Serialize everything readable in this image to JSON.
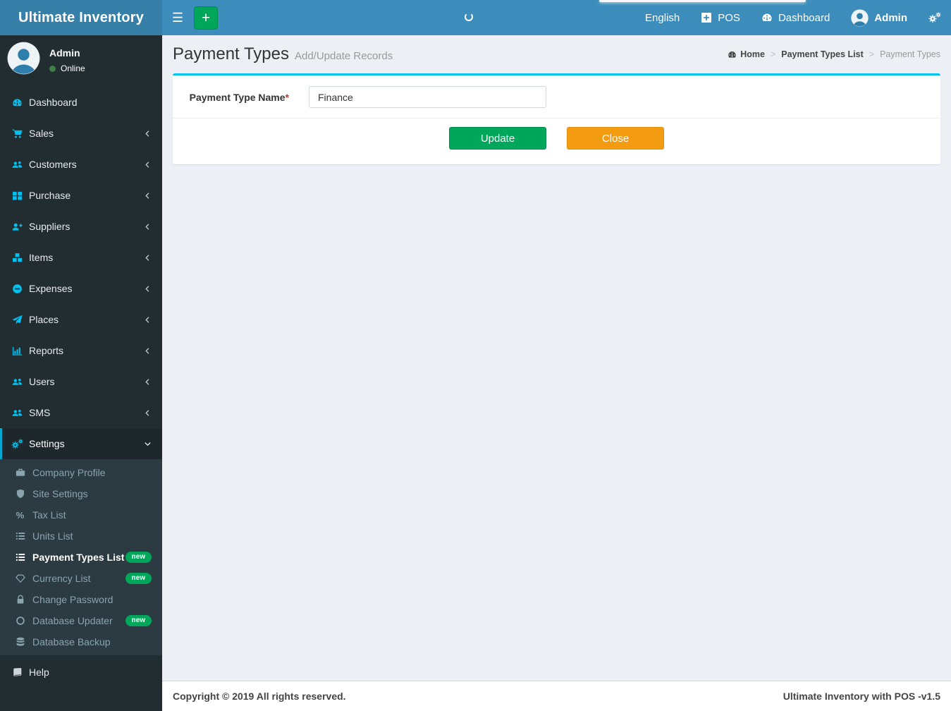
{
  "app": {
    "title": "Ultimate Inventory"
  },
  "navbar": {
    "language": "English",
    "pos": "POS",
    "dashboard": "Dashboard",
    "user": "Admin"
  },
  "sidebar": {
    "user": {
      "name": "Admin",
      "status": "Online"
    },
    "items": [
      {
        "label": "Dashboard",
        "expandable": false
      },
      {
        "label": "Sales",
        "expandable": true
      },
      {
        "label": "Customers",
        "expandable": true
      },
      {
        "label": "Purchase",
        "expandable": true
      },
      {
        "label": "Suppliers",
        "expandable": true
      },
      {
        "label": "Items",
        "expandable": true
      },
      {
        "label": "Expenses",
        "expandable": true
      },
      {
        "label": "Places",
        "expandable": true
      },
      {
        "label": "Reports",
        "expandable": true
      },
      {
        "label": "Users",
        "expandable": true
      },
      {
        "label": "SMS",
        "expandable": true
      },
      {
        "label": "Settings",
        "expandable": true,
        "active": true
      }
    ],
    "submenu": [
      {
        "label": "Company Profile"
      },
      {
        "label": "Site Settings"
      },
      {
        "label": "Tax List"
      },
      {
        "label": "Units List"
      },
      {
        "label": "Payment Types List",
        "badge": "new",
        "active": true
      },
      {
        "label": "Currency List",
        "badge": "new"
      },
      {
        "label": "Change Password"
      },
      {
        "label": "Database Updater",
        "badge": "new"
      },
      {
        "label": "Database Backup"
      }
    ],
    "help": {
      "label": "Help"
    }
  },
  "page": {
    "title": "Payment Types",
    "subtitle": "Add/Update Records"
  },
  "breadcrumb": {
    "home": "Home",
    "level1": "Payment Types List",
    "current": "Payment Types",
    "separator": ">"
  },
  "form": {
    "label": "Payment Type Name",
    "required_mark": "*",
    "value": "Finance",
    "update_label": "Update",
    "close_label": "Close"
  },
  "footer": {
    "copyright": "Copyright © 2019 All rights reserved.",
    "brand": "Ultimate Inventory with POS",
    "version": "-v1.5"
  },
  "icons": {
    "menu-toggle-icon": "hamburger ☰",
    "add-icon": "plus +",
    "spinner-icon": "white loading arc",
    "pos-icon": "plus-square",
    "dashboard-icon": "tachometer gauge",
    "user-avatar-icon": "person silhouette circle",
    "gears-icon": "double cogs",
    "sales-icon": "shopping-cart",
    "customers-icon": "users group",
    "purchase-icon": "th-large squares",
    "suppliers-icon": "user-plus",
    "items-icon": "cubes",
    "expenses-icon": "minus-circle",
    "places-icon": "paper-plane",
    "reports-icon": "bar-chart",
    "sms-icon": "users group",
    "settings-icon": "cogs",
    "company-profile-icon": "suitcase",
    "site-settings-icon": "shield",
    "tax-icon": "percent %",
    "list-icon": "list rows",
    "currency-icon": "diamond outline",
    "password-icon": "lock",
    "updater-icon": "circle outline",
    "backup-icon": "database stack",
    "help-icon": "book",
    "chevron-left-icon": "angle <",
    "chevron-down-icon": "angle v"
  },
  "colors": {
    "navbar": "#3c8dbc",
    "logo_bg": "#367fa9",
    "sidebar_bg": "#222d32",
    "submenu_bg": "#2c3b41",
    "active_bg": "#1e282c",
    "accent_cyan": "#00c0ef",
    "active_border": "#00a7d0",
    "green": "#00a65a",
    "orange": "#f39c12",
    "content_bg": "#ecf0f5",
    "badge_green": "#00a65a",
    "online_dot": "#3f7e44"
  }
}
